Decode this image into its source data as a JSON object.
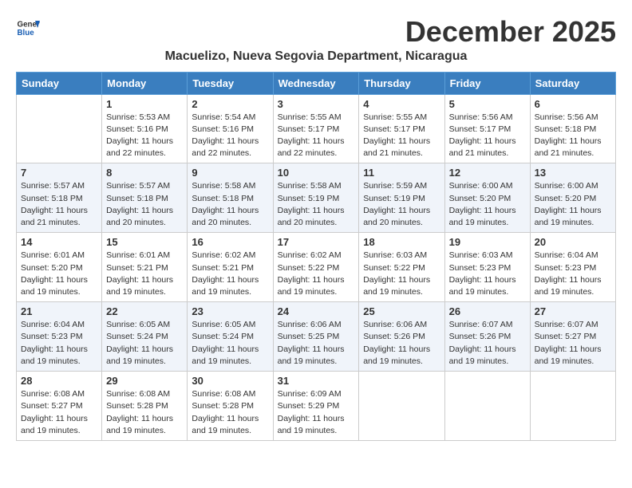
{
  "header": {
    "logo_line1": "General",
    "logo_line2": "Blue",
    "month_year": "December 2025",
    "location": "Macuelizo, Nueva Segovia Department, Nicaragua"
  },
  "days_of_week": [
    "Sunday",
    "Monday",
    "Tuesday",
    "Wednesday",
    "Thursday",
    "Friday",
    "Saturday"
  ],
  "weeks": [
    [
      {
        "day": "",
        "info": ""
      },
      {
        "day": "1",
        "info": "Sunrise: 5:53 AM\nSunset: 5:16 PM\nDaylight: 11 hours\nand 22 minutes."
      },
      {
        "day": "2",
        "info": "Sunrise: 5:54 AM\nSunset: 5:16 PM\nDaylight: 11 hours\nand 22 minutes."
      },
      {
        "day": "3",
        "info": "Sunrise: 5:55 AM\nSunset: 5:17 PM\nDaylight: 11 hours\nand 22 minutes."
      },
      {
        "day": "4",
        "info": "Sunrise: 5:55 AM\nSunset: 5:17 PM\nDaylight: 11 hours\nand 21 minutes."
      },
      {
        "day": "5",
        "info": "Sunrise: 5:56 AM\nSunset: 5:17 PM\nDaylight: 11 hours\nand 21 minutes."
      },
      {
        "day": "6",
        "info": "Sunrise: 5:56 AM\nSunset: 5:18 PM\nDaylight: 11 hours\nand 21 minutes."
      }
    ],
    [
      {
        "day": "7",
        "info": "Sunrise: 5:57 AM\nSunset: 5:18 PM\nDaylight: 11 hours\nand 21 minutes."
      },
      {
        "day": "8",
        "info": "Sunrise: 5:57 AM\nSunset: 5:18 PM\nDaylight: 11 hours\nand 20 minutes."
      },
      {
        "day": "9",
        "info": "Sunrise: 5:58 AM\nSunset: 5:18 PM\nDaylight: 11 hours\nand 20 minutes."
      },
      {
        "day": "10",
        "info": "Sunrise: 5:58 AM\nSunset: 5:19 PM\nDaylight: 11 hours\nand 20 minutes."
      },
      {
        "day": "11",
        "info": "Sunrise: 5:59 AM\nSunset: 5:19 PM\nDaylight: 11 hours\nand 20 minutes."
      },
      {
        "day": "12",
        "info": "Sunrise: 6:00 AM\nSunset: 5:20 PM\nDaylight: 11 hours\nand 19 minutes."
      },
      {
        "day": "13",
        "info": "Sunrise: 6:00 AM\nSunset: 5:20 PM\nDaylight: 11 hours\nand 19 minutes."
      }
    ],
    [
      {
        "day": "14",
        "info": "Sunrise: 6:01 AM\nSunset: 5:20 PM\nDaylight: 11 hours\nand 19 minutes."
      },
      {
        "day": "15",
        "info": "Sunrise: 6:01 AM\nSunset: 5:21 PM\nDaylight: 11 hours\nand 19 minutes."
      },
      {
        "day": "16",
        "info": "Sunrise: 6:02 AM\nSunset: 5:21 PM\nDaylight: 11 hours\nand 19 minutes."
      },
      {
        "day": "17",
        "info": "Sunrise: 6:02 AM\nSunset: 5:22 PM\nDaylight: 11 hours\nand 19 minutes."
      },
      {
        "day": "18",
        "info": "Sunrise: 6:03 AM\nSunset: 5:22 PM\nDaylight: 11 hours\nand 19 minutes."
      },
      {
        "day": "19",
        "info": "Sunrise: 6:03 AM\nSunset: 5:23 PM\nDaylight: 11 hours\nand 19 minutes."
      },
      {
        "day": "20",
        "info": "Sunrise: 6:04 AM\nSunset: 5:23 PM\nDaylight: 11 hours\nand 19 minutes."
      }
    ],
    [
      {
        "day": "21",
        "info": "Sunrise: 6:04 AM\nSunset: 5:23 PM\nDaylight: 11 hours\nand 19 minutes."
      },
      {
        "day": "22",
        "info": "Sunrise: 6:05 AM\nSunset: 5:24 PM\nDaylight: 11 hours\nand 19 minutes."
      },
      {
        "day": "23",
        "info": "Sunrise: 6:05 AM\nSunset: 5:24 PM\nDaylight: 11 hours\nand 19 minutes."
      },
      {
        "day": "24",
        "info": "Sunrise: 6:06 AM\nSunset: 5:25 PM\nDaylight: 11 hours\nand 19 minutes."
      },
      {
        "day": "25",
        "info": "Sunrise: 6:06 AM\nSunset: 5:26 PM\nDaylight: 11 hours\nand 19 minutes."
      },
      {
        "day": "26",
        "info": "Sunrise: 6:07 AM\nSunset: 5:26 PM\nDaylight: 11 hours\nand 19 minutes."
      },
      {
        "day": "27",
        "info": "Sunrise: 6:07 AM\nSunset: 5:27 PM\nDaylight: 11 hours\nand 19 minutes."
      }
    ],
    [
      {
        "day": "28",
        "info": "Sunrise: 6:08 AM\nSunset: 5:27 PM\nDaylight: 11 hours\nand 19 minutes."
      },
      {
        "day": "29",
        "info": "Sunrise: 6:08 AM\nSunset: 5:28 PM\nDaylight: 11 hours\nand 19 minutes."
      },
      {
        "day": "30",
        "info": "Sunrise: 6:08 AM\nSunset: 5:28 PM\nDaylight: 11 hours\nand 19 minutes."
      },
      {
        "day": "31",
        "info": "Sunrise: 6:09 AM\nSunset: 5:29 PM\nDaylight: 11 hours\nand 19 minutes."
      },
      {
        "day": "",
        "info": ""
      },
      {
        "day": "",
        "info": ""
      },
      {
        "day": "",
        "info": ""
      }
    ]
  ]
}
